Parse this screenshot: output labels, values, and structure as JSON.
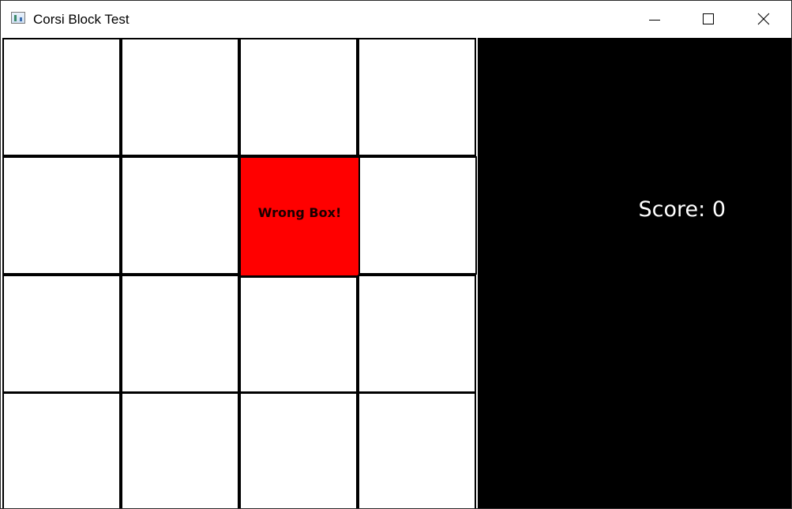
{
  "window": {
    "title": "Corsi Block Test",
    "icon": "app-window-icon",
    "controls": [
      "minimize-icon",
      "maximize-icon",
      "close-icon"
    ]
  },
  "board": {
    "rows": 4,
    "cols": 4,
    "highlighted_cell": {
      "row": 1,
      "col": 2,
      "label": "Wrong Box!",
      "color": "#ff0000"
    },
    "cell_color": "#ffffff",
    "border_color": "#000000"
  },
  "score_panel": {
    "score_label": "Score: 0",
    "background": "#000000",
    "text_color": "#ffffff"
  }
}
